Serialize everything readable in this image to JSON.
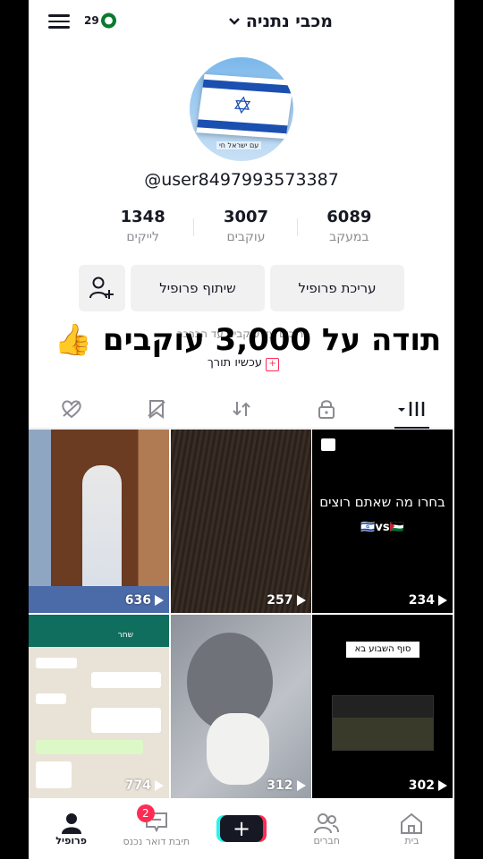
{
  "header": {
    "title": "מכבי נתניה",
    "logo_text": "29"
  },
  "profile": {
    "username": "@user8497993573387",
    "avatar_caption": "עם ישראל חי",
    "stats": [
      {
        "number": "6089",
        "label": "במעקב"
      },
      {
        "number": "3007",
        "label": "עוקבים"
      },
      {
        "number": "1348",
        "label": "לייקים"
      }
    ],
    "buttons": {
      "edit": "עריכת פרופיל",
      "share": "שיתוף פרופיל"
    },
    "bio_ghost": "ברוכים עד עוקבים עד הכרכר",
    "bio_link": "עכשיו תורך",
    "overlay_banner": "תודה על 3,000 עוקבים 👍"
  },
  "videos": [
    {
      "views": "636",
      "text": ""
    },
    {
      "views": "257",
      "text": ""
    },
    {
      "views": "234",
      "text": "בחרו מה שאתם רוצים",
      "sub": "🇮🇱vs🇵🇸"
    },
    {
      "views": "774",
      "text": "שחר"
    },
    {
      "views": "312",
      "text": ""
    },
    {
      "views": "302",
      "text": "סוף השבוע בא"
    }
  ],
  "nav": {
    "items": [
      {
        "label": "בית"
      },
      {
        "label": "חברים"
      },
      {
        "label": ""
      },
      {
        "label": "תיבת דואר נכנס",
        "badge": "2"
      },
      {
        "label": "פרופיל"
      }
    ]
  },
  "colors": {
    "accent_red": "#fe2c55",
    "accent_cyan": "#25f4ee",
    "text": "#161823",
    "muted": "#8a8b91"
  }
}
